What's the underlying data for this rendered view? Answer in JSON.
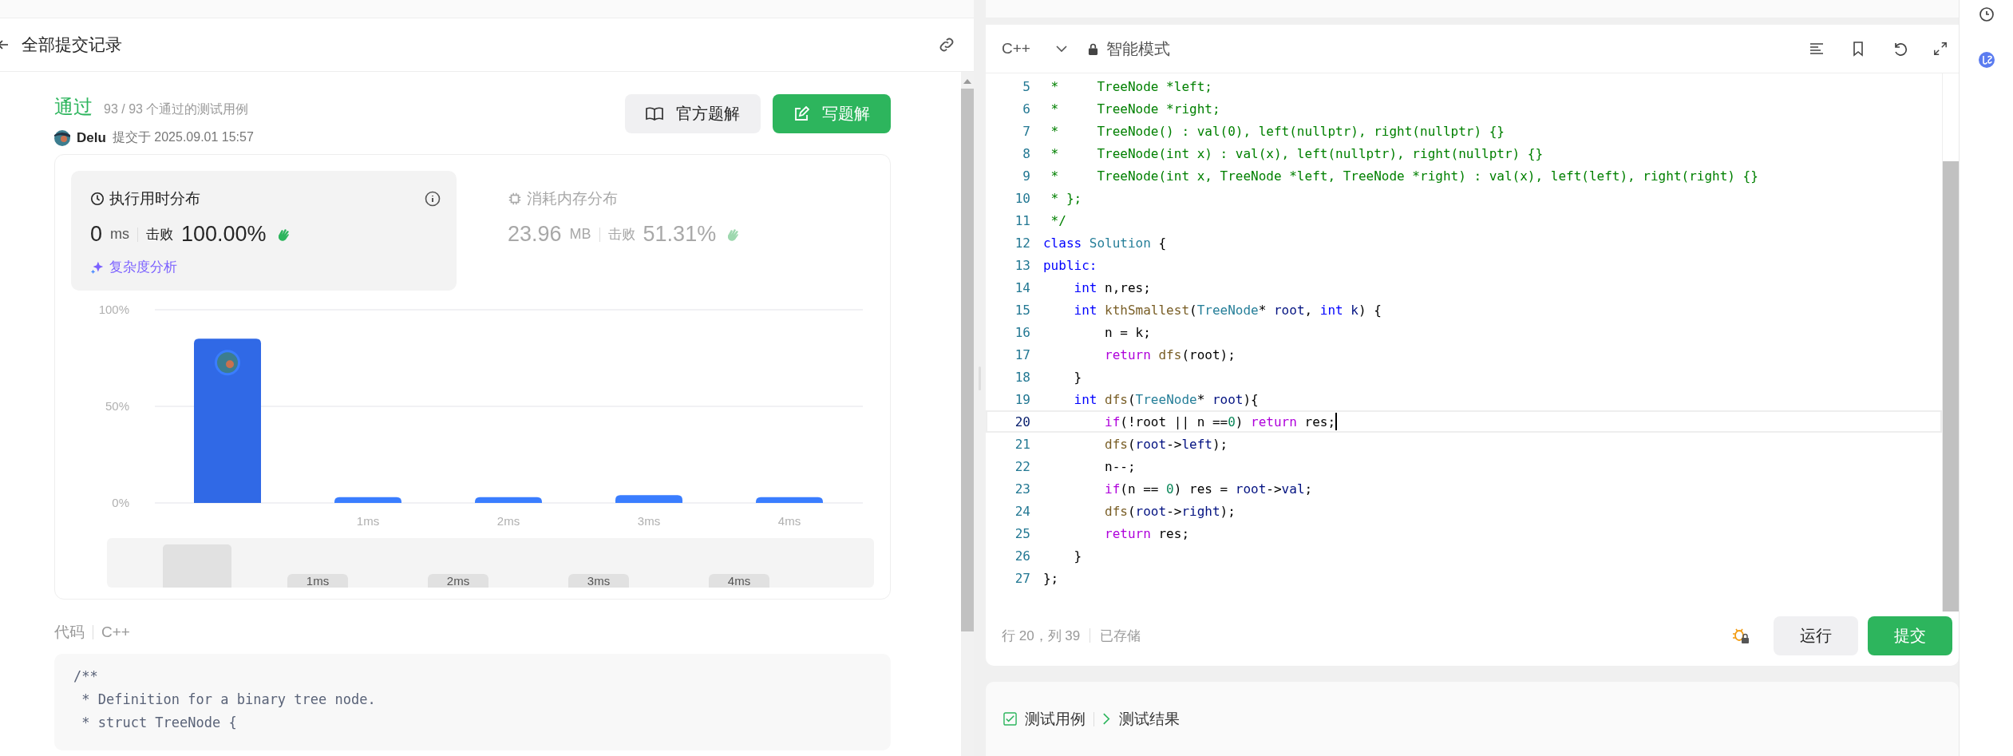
{
  "header": {
    "title": "全部提交记录"
  },
  "result": {
    "status": "通过",
    "cases": "93 / 93 个通过的测试用例",
    "user": "Delu",
    "submitted": "提交于 2025.09.01 15:57"
  },
  "actions": [
    {
      "label": "官方题解",
      "kind": "secondary"
    },
    {
      "label": "写题解",
      "kind": "primary"
    }
  ],
  "stats": [
    {
      "title": "执行用时分布",
      "value": "0",
      "unit": "ms",
      "beat_label": "击败",
      "beat": "100.00%",
      "selected": true,
      "extra": "复杂度分析"
    },
    {
      "title": "消耗内存分布",
      "value": "23.96",
      "unit": "MB",
      "beat_label": "击败",
      "beat": "51.31%",
      "selected": false
    }
  ],
  "chart_data": {
    "type": "bar",
    "categories": [
      null,
      "1ms",
      "2ms",
      "3ms",
      "4ms"
    ],
    "values": [
      85,
      3,
      3,
      4,
      3
    ],
    "ylim": [
      0,
      100
    ],
    "yticks": [
      {
        "value": 0,
        "label": "0%"
      },
      {
        "value": 50,
        "label": "50%"
      },
      {
        "value": 100,
        "label": "100%"
      }
    ]
  },
  "navigator": {
    "labels": [
      "1ms",
      "2ms",
      "3ms",
      "4ms"
    ]
  },
  "code_section": {
    "label": "代码",
    "language": "C++",
    "lines": [
      "/**",
      " * Definition for a binary tree node.",
      " * struct TreeNode {"
    ]
  },
  "editor": {
    "language": "C++",
    "mode": "智能模式",
    "lines": [
      {
        "number": "5",
        "current": false,
        "tokens": [
          {
            "text": " *     TreeNode *left;",
            "kind": "comment"
          }
        ]
      },
      {
        "number": "6",
        "current": false,
        "tokens": [
          {
            "text": " *     TreeNode *right;",
            "kind": "comment"
          }
        ]
      },
      {
        "number": "7",
        "current": false,
        "tokens": [
          {
            "text": " *     TreeNode() : val(0), left(nullptr), right(nullptr) {}",
            "kind": "comment"
          }
        ]
      },
      {
        "number": "8",
        "current": false,
        "tokens": [
          {
            "text": " *     TreeNode(int x) : val(x), left(nullptr), right(nullptr) {}",
            "kind": "comment"
          }
        ]
      },
      {
        "number": "9",
        "current": false,
        "tokens": [
          {
            "text": " *     TreeNode(int x, TreeNode *left, TreeNode *right) : val(x), left(left), right(right) {}",
            "kind": "comment"
          }
        ]
      },
      {
        "number": "10",
        "current": false,
        "tokens": [
          {
            "text": " * };",
            "kind": "comment"
          }
        ]
      },
      {
        "number": "11",
        "current": false,
        "tokens": [
          {
            "text": " */",
            "kind": "comment"
          }
        ]
      },
      {
        "number": "12",
        "current": false,
        "tokens": [
          {
            "text": "class",
            "kind": "keyword"
          },
          {
            "text": " Solution",
            "kind": "type"
          },
          {
            "text": " {",
            "kind": "plain"
          }
        ]
      },
      {
        "number": "13",
        "current": false,
        "tokens": [
          {
            "text": "public:",
            "kind": "keyword"
          }
        ]
      },
      {
        "number": "14",
        "current": false,
        "tokens": [
          {
            "text": "    int",
            "kind": "keyword"
          },
          {
            "text": " n,res;",
            "kind": "plain"
          }
        ]
      },
      {
        "number": "15",
        "current": false,
        "tokens": [
          {
            "text": "    int",
            "kind": "keyword"
          },
          {
            "text": " kthSmallest",
            "kind": "function"
          },
          {
            "text": "(",
            "kind": "plain"
          },
          {
            "text": "TreeNode",
            "kind": "type"
          },
          {
            "text": "* ",
            "kind": "plain"
          },
          {
            "text": "root",
            "kind": "variable"
          },
          {
            "text": ", ",
            "kind": "plain"
          },
          {
            "text": "int",
            "kind": "keyword"
          },
          {
            "text": " k",
            "kind": "variable"
          },
          {
            "text": ") {",
            "kind": "plain"
          }
        ]
      },
      {
        "number": "16",
        "current": false,
        "tokens": [
          {
            "text": "        n = k;",
            "kind": "plain"
          }
        ]
      },
      {
        "number": "17",
        "current": false,
        "tokens": [
          {
            "text": "        return",
            "kind": "control"
          },
          {
            "text": " dfs",
            "kind": "function"
          },
          {
            "text": "(root);",
            "kind": "plain"
          }
        ]
      },
      {
        "number": "18",
        "current": false,
        "tokens": [
          {
            "text": "    }",
            "kind": "plain"
          }
        ]
      },
      {
        "number": "19",
        "current": false,
        "tokens": [
          {
            "text": "    int",
            "kind": "keyword"
          },
          {
            "text": " dfs",
            "kind": "function"
          },
          {
            "text": "(",
            "kind": "plain"
          },
          {
            "text": "TreeNode",
            "kind": "type"
          },
          {
            "text": "* ",
            "kind": "plain"
          },
          {
            "text": "root",
            "kind": "variable"
          },
          {
            "text": "){",
            "kind": "plain"
          }
        ]
      },
      {
        "number": "20",
        "current": true,
        "tokens": [
          {
            "text": "        if",
            "kind": "control"
          },
          {
            "text": "(!root || n ==",
            "kind": "plain"
          },
          {
            "text": "0",
            "kind": "number"
          },
          {
            "text": ") ",
            "kind": "plain"
          },
          {
            "text": "return",
            "kind": "control"
          },
          {
            "text": " res;",
            "kind": "plain"
          }
        ]
      },
      {
        "number": "21",
        "current": false,
        "tokens": [
          {
            "text": "        dfs",
            "kind": "function"
          },
          {
            "text": "(",
            "kind": "plain"
          },
          {
            "text": "root",
            "kind": "variable"
          },
          {
            "text": "->",
            "kind": "plain"
          },
          {
            "text": "left",
            "kind": "variable"
          },
          {
            "text": ");",
            "kind": "plain"
          }
        ]
      },
      {
        "number": "22",
        "current": false,
        "tokens": [
          {
            "text": "        n--;",
            "kind": "plain"
          }
        ]
      },
      {
        "number": "23",
        "current": false,
        "tokens": [
          {
            "text": "        if",
            "kind": "control"
          },
          {
            "text": "(n == ",
            "kind": "plain"
          },
          {
            "text": "0",
            "kind": "number"
          },
          {
            "text": ") res = ",
            "kind": "plain"
          },
          {
            "text": "root",
            "kind": "variable"
          },
          {
            "text": "->",
            "kind": "plain"
          },
          {
            "text": "val",
            "kind": "variable"
          },
          {
            "text": ";",
            "kind": "plain"
          }
        ]
      },
      {
        "number": "24",
        "current": false,
        "tokens": [
          {
            "text": "        dfs",
            "kind": "function"
          },
          {
            "text": "(",
            "kind": "plain"
          },
          {
            "text": "root",
            "kind": "variable"
          },
          {
            "text": "->",
            "kind": "plain"
          },
          {
            "text": "right",
            "kind": "variable"
          },
          {
            "text": ");",
            "kind": "plain"
          }
        ]
      },
      {
        "number": "25",
        "current": false,
        "tokens": [
          {
            "text": "        return",
            "kind": "control"
          },
          {
            "text": " res;",
            "kind": "plain"
          }
        ]
      },
      {
        "number": "26",
        "current": false,
        "tokens": [
          {
            "text": "    }",
            "kind": "plain"
          }
        ]
      },
      {
        "number": "27",
        "current": false,
        "tokens": [
          {
            "text": "};",
            "kind": "plain"
          }
        ]
      }
    ],
    "position": "行 20，列 39",
    "saved": "已存储",
    "buttons": [
      {
        "label": "运行",
        "kind": "secondary"
      },
      {
        "label": "提交",
        "kind": "primary"
      }
    ]
  },
  "bottom_panel": {
    "tabs": [
      {
        "label": "测试用例",
        "kind": "cases"
      },
      {
        "label": "测试结果",
        "kind": "results"
      }
    ]
  }
}
